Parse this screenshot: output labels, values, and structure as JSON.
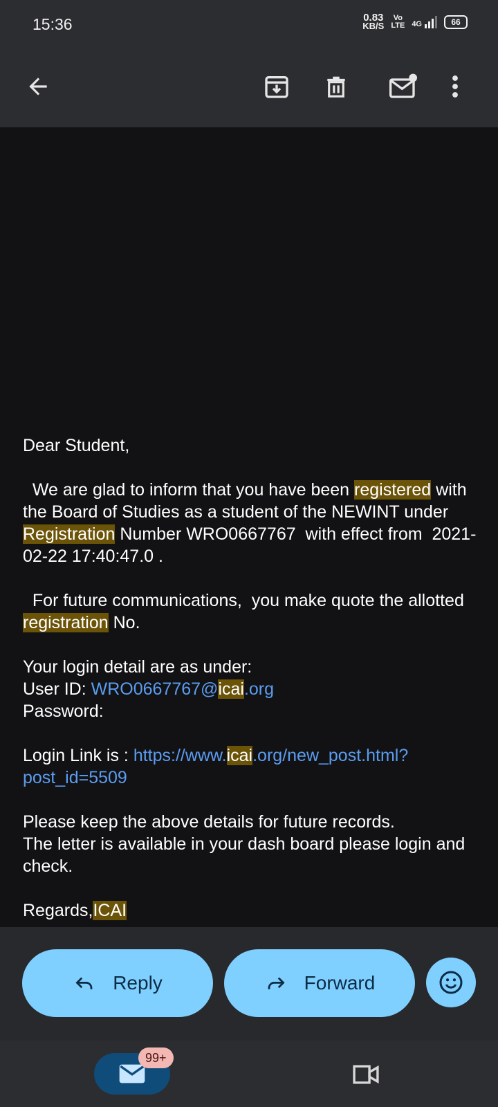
{
  "status_bar": {
    "time": "15:36",
    "net_speed": "0.83",
    "net_unit": "KB/S",
    "volte_top": "Vo",
    "volte_bottom": "LTE",
    "network": "4G",
    "battery": "66"
  },
  "toolbar": {
    "back_icon": "arrow-left-icon",
    "archive_icon": "archive-icon",
    "delete_icon": "trash-icon",
    "mark_unread_icon": "mail-unread-icon",
    "more_icon": "more-vertical-icon"
  },
  "email": {
    "greeting": "Dear Student,",
    "p1_a": "  We are glad to inform that you have been ",
    "p1_hl1": "registered",
    "p1_b": " with the Board of Studies as a student of the NEWINT under ",
    "p1_hl2": "Registration",
    "p1_c": " Number WRO0667767  with effect from  2021-02-22 17:40:47.0 .",
    "p2_a": "  For future communications,  you make quote the allotted ",
    "p2_hl": "registration",
    "p2_b": " No.",
    "login_intro": "Your login detail are as under:",
    "userid_label": "User ID: ",
    "userid_link_a": "WRO0667767@",
    "userid_link_hl": "icai",
    "userid_link_b": ".org",
    "password_label": "Password:",
    "loginlink_label": "Login Link is : ",
    "loginlink_a": "https://www.",
    "loginlink_hl": "icai",
    "loginlink_b": ".org/new_post.html?post_id=5509",
    "keep_line": "Please keep the above details for future records.",
    "letter_line": "The letter is available in your dash board please login and check.",
    "regards": "Regards,",
    "regards_hl": "ICAI"
  },
  "actions": {
    "reply_label": "Reply",
    "forward_label": "Forward",
    "emoji_icon": "smiley-icon"
  },
  "bottom_nav": {
    "mail_badge": "99+",
    "mail_icon": "mail-icon",
    "meet_icon": "video-camera-icon"
  },
  "colors": {
    "highlight": "#6b5308",
    "link": "#5b9cf0",
    "button": "#7fcfff"
  }
}
